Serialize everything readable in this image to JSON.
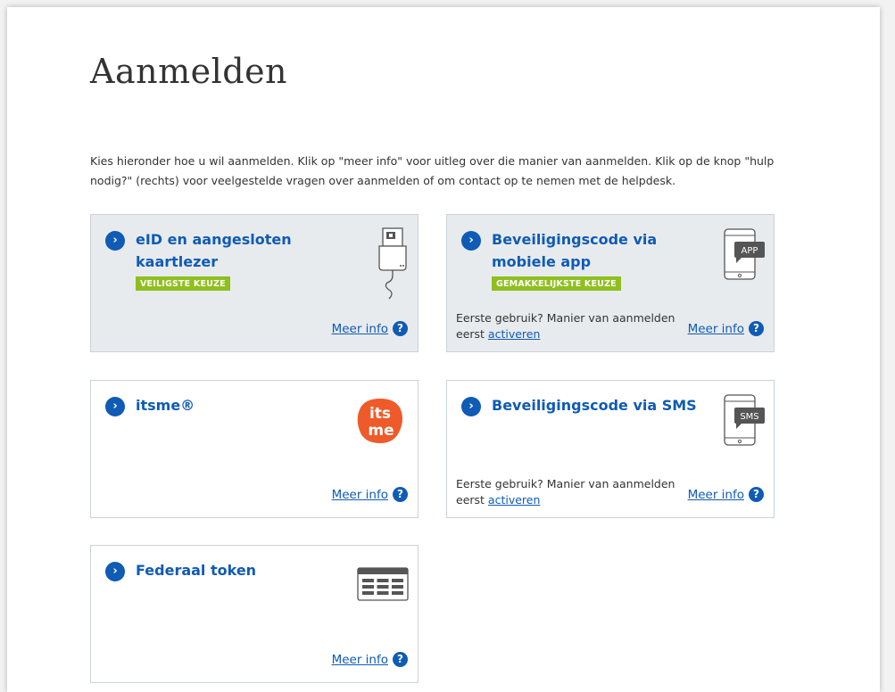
{
  "page": {
    "title": "Aanmelden",
    "intro": "Kies hieronder hoe u wil aanmelden. Klik op \"meer info\" voor uitleg over die manier van aanmelden. Klik op de knop \"hulp nodig?\" (rechts) voor veelgestelde vragen over aanmelden of om contact op te nemen met de helpdesk."
  },
  "common": {
    "meer_info": "Meer info",
    "help_glyph": "?",
    "arrow_glyph": "›",
    "first_use_text": "Eerste gebruik? Manier van aanmelden eerst ",
    "activate_link": "activeren"
  },
  "options": {
    "eid": {
      "label": "eID en aangesloten kaartlezer",
      "badge": "VEILIGSTE KEUZE",
      "icon": "card-reader-icon"
    },
    "mobile_app": {
      "label": "Beveiligingscode via mobiele app",
      "badge": "GEMAKKELIJKSTE KEUZE",
      "icon": "phone-app-icon",
      "icon_text": "APP"
    },
    "itsme": {
      "label": "itsme®",
      "icon": "itsme-logo",
      "logo_text_top": "its",
      "logo_text_bottom": "me"
    },
    "sms": {
      "label": "Beveiligingscode via SMS",
      "icon": "phone-sms-icon",
      "icon_text": "SMS"
    },
    "token": {
      "label": "Federaal token",
      "icon": "token-card-icon"
    }
  },
  "colors": {
    "brand_blue": "#0f5bb5",
    "badge_green": "#8fbf1f",
    "itsme_orange": "#ee5a29",
    "card_grey": "#e8ebee"
  }
}
